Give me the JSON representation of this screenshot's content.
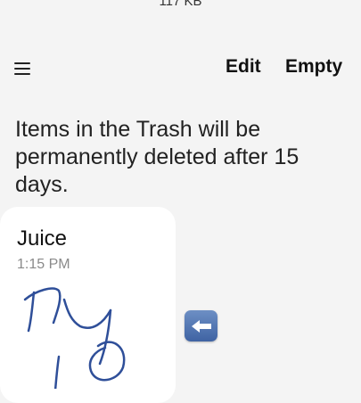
{
  "header": {
    "file_size": "117 KB"
  },
  "toolbar": {
    "edit_label": "Edit",
    "empty_label": "Empty"
  },
  "notice": {
    "text": "Items in the Trash will be permanently deleted after 15 days."
  },
  "note": {
    "title": "Juice",
    "time": "1:15 PM",
    "handwriting_color": "#2f4f99"
  },
  "icons": {
    "menu": "hamburger-menu-icon",
    "restore": "arrow-left-icon"
  }
}
